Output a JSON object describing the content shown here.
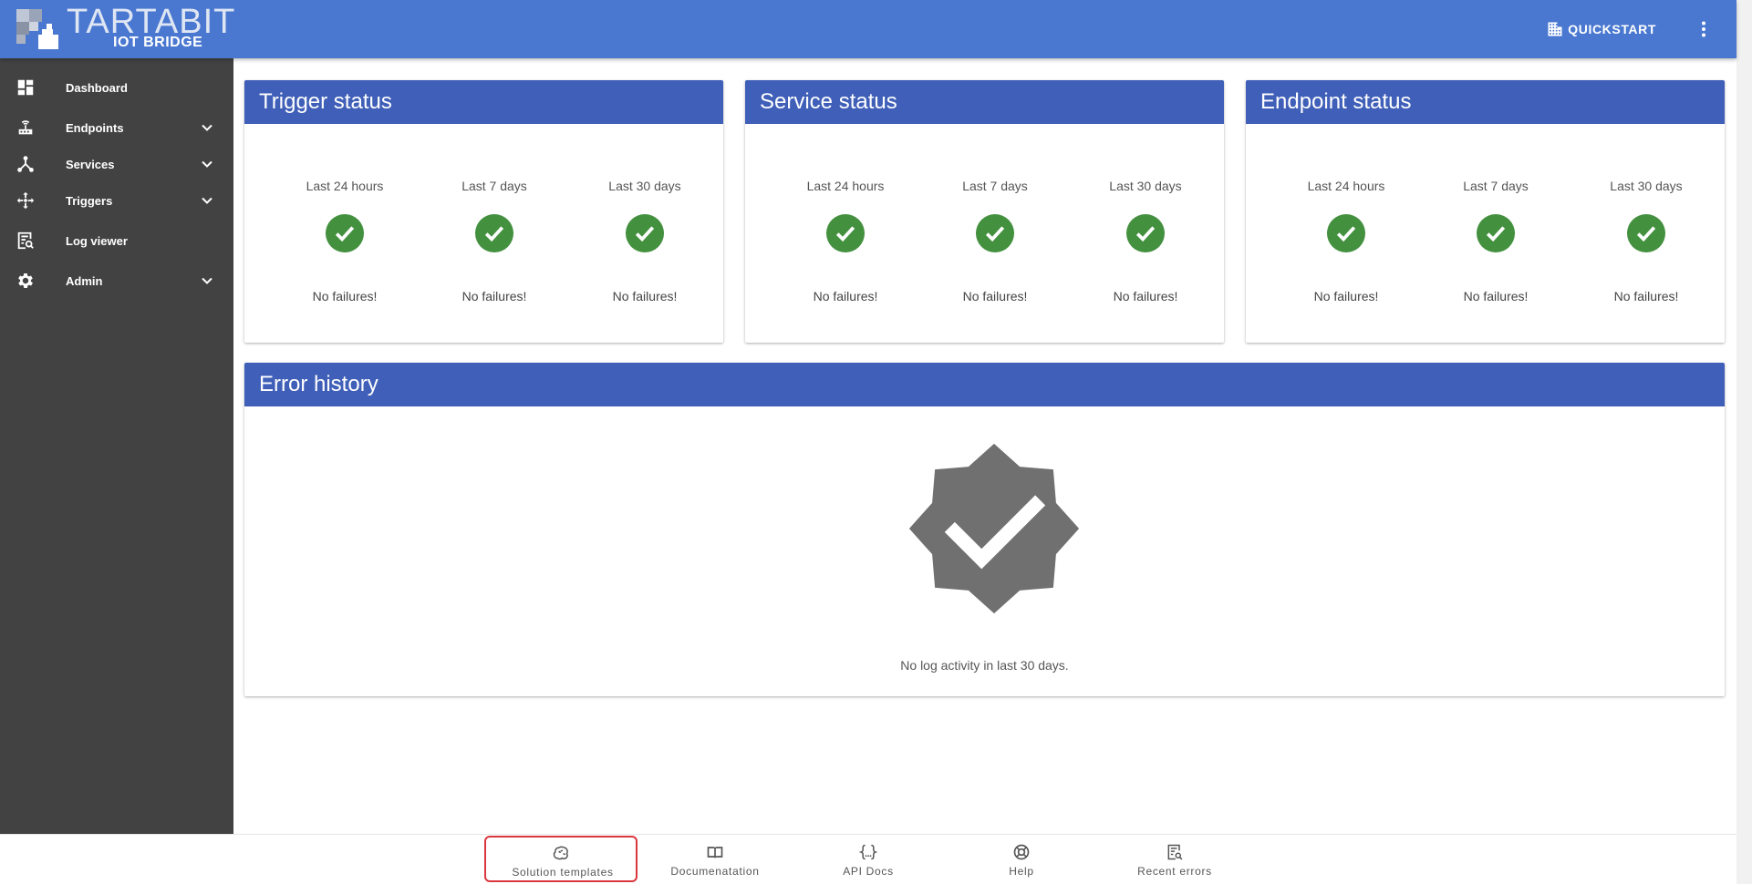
{
  "topbar": {
    "logo_title": "TARTABIT",
    "logo_subtitle": "IOT BRIDGE",
    "quickstart_label": "QUICKSTART"
  },
  "sidebar": {
    "items": [
      {
        "label": "Dashboard",
        "icon": "dashboard-icon",
        "expandable": false
      },
      {
        "label": "Endpoints",
        "icon": "router-icon",
        "expandable": true
      },
      {
        "label": "Services",
        "icon": "hub-icon",
        "expandable": true
      },
      {
        "label": "Triggers",
        "icon": "arrows-icon",
        "expandable": true
      },
      {
        "label": "Log viewer",
        "icon": "log-search-icon",
        "expandable": false
      },
      {
        "label": "Admin",
        "icon": "gear-icon",
        "expandable": true
      }
    ]
  },
  "trigger_status": {
    "title": "Trigger status",
    "columns": [
      {
        "period": "Last 24 hours",
        "message": "No failures!"
      },
      {
        "period": "Last 7 days",
        "message": "No failures!"
      },
      {
        "period": "Last 30 days",
        "message": "No failures!"
      }
    ]
  },
  "service_status": {
    "title": "Service status",
    "columns": [
      {
        "period": "Last 24 hours",
        "message": "No failures!"
      },
      {
        "period": "Last 7 days",
        "message": "No failures!"
      },
      {
        "period": "Last 30 days",
        "message": "No failures!"
      }
    ]
  },
  "endpoint_status": {
    "title": "Endpoint status",
    "columns": [
      {
        "period": "Last 24 hours",
        "message": "No failures!"
      },
      {
        "period": "Last 7 days",
        "message": "No failures!"
      },
      {
        "period": "Last 30 days",
        "message": "No failures!"
      }
    ]
  },
  "error_history": {
    "title": "Error history",
    "message": "No log activity in last 30 days."
  },
  "bottom_nav": {
    "items": [
      {
        "label": "Solution templates",
        "icon": "brain-icon",
        "selected": true
      },
      {
        "label": "Documenatation",
        "icon": "book-icon",
        "selected": false
      },
      {
        "label": "API Docs",
        "icon": "code-braces-icon",
        "selected": false
      },
      {
        "label": "Help",
        "icon": "lifebuoy-icon",
        "selected": false
      },
      {
        "label": "Recent errors",
        "icon": "report-search-icon",
        "selected": false
      }
    ]
  },
  "colors": {
    "topbar": "#4a78d0",
    "sidebar": "#424242",
    "card_header": "#3f5fb8",
    "success": "#43903f",
    "badge": "#707070",
    "selected_outline": "#d9363e"
  }
}
